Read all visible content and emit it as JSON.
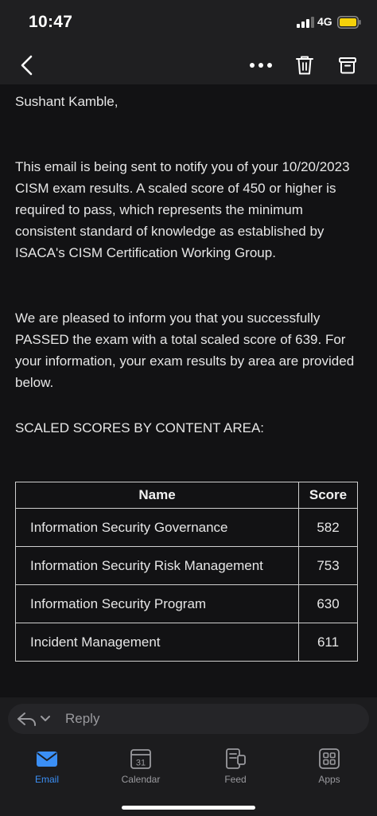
{
  "status_bar": {
    "time": "10:47",
    "network": "4G",
    "battery_color": "#f5d10a"
  },
  "toolbar": {
    "back_icon": "chevron-left-icon",
    "more_icon": "more-horizontal-icon",
    "delete_icon": "trash-icon",
    "archive_icon": "archive-icon"
  },
  "email": {
    "greeting": "Sushant Kamble,",
    "paragraphs": [
      "This email is being sent to notify you of your 10/20/2023 CISM exam results. A scaled score of 450 or higher is required to pass, which represents the minimum consistent standard of knowledge as established by ISACA's CISM Certification Working Group.",
      "We are pleased to inform you that you successfully PASSED the exam with a total scaled score of 639. For your information, your exam results by area are provided below.",
      "SCALED SCORES BY CONTENT AREA:"
    ],
    "table": {
      "headers": [
        "Name",
        "Score"
      ],
      "rows": [
        {
          "name": "Information Security Governance",
          "score": "582"
        },
        {
          "name": "Information Security Risk Management",
          "score": "753"
        },
        {
          "name": "Information Security Program",
          "score": "630"
        },
        {
          "name": "Incident Management",
          "score": "611"
        }
      ]
    }
  },
  "reply_bar": {
    "placeholder": "Reply",
    "reply_icon": "reply-arrow-icon",
    "dropdown_icon": "chevron-down-icon"
  },
  "tabs": [
    {
      "label": "Email",
      "icon": "email-icon",
      "active": true
    },
    {
      "label": "Calendar",
      "icon": "calendar-icon",
      "active": false,
      "calendar_day": "31"
    },
    {
      "label": "Feed",
      "icon": "feed-icon",
      "active": false
    },
    {
      "label": "Apps",
      "icon": "apps-icon",
      "active": false
    }
  ],
  "colors": {
    "accent": "#3b8ff5",
    "background": "#121214",
    "text": "#e6e6e6"
  }
}
